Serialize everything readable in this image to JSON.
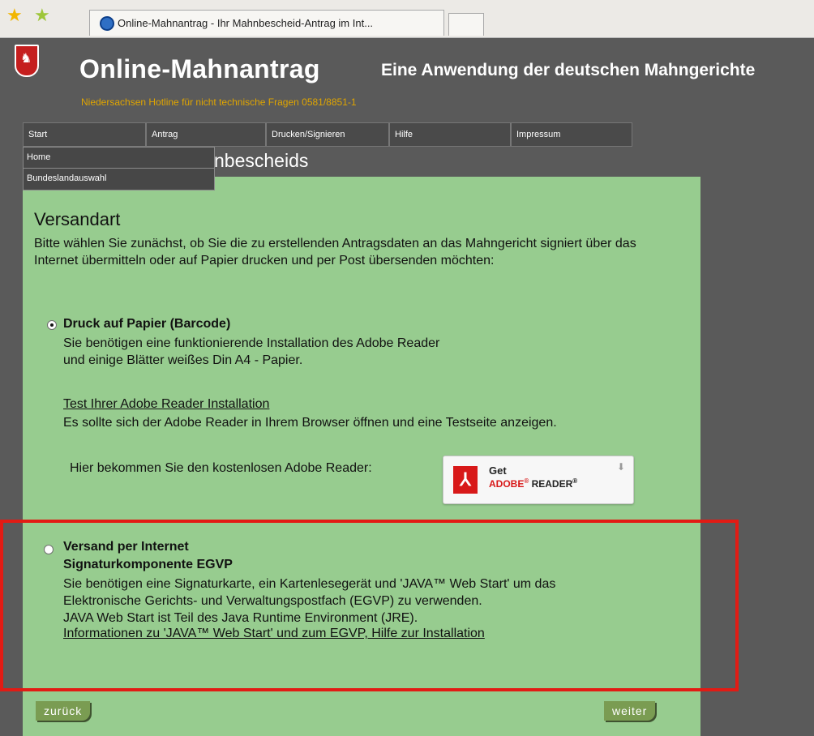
{
  "browser": {
    "tab_title": "Online-Mahnantrag - Ihr Mahnbescheid-Antrag im Int..."
  },
  "header": {
    "title": "Online-Mahnantrag",
    "subtitle": "Eine Anwendung der deutschen Mahngerichte",
    "info": "Niedersachsen   Hotline für nicht technische Fragen 0581/8851-1"
  },
  "nav": {
    "items": [
      {
        "label": "Start"
      },
      {
        "label": "Antrag"
      },
      {
        "label": "Drucken/Signieren"
      },
      {
        "label": "Hilfe"
      },
      {
        "label": "Impressum"
      }
    ],
    "dropdown": [
      "Home",
      "Bundeslandauswahl"
    ]
  },
  "main": {
    "heading": "s eines Mahnbescheids",
    "section_title": "Versandart",
    "intro": "Bitte wählen Sie zunächst, ob Sie die zu erstellenden Antragsdaten an das Mahngericht signiert über das Internet übermitteln oder auf Papier drucken und per Post übersenden möchten:",
    "option_paper": {
      "label": "Druck auf Papier (Barcode)",
      "line1": "Sie benötigen eine funktionierende Installation des Adobe Reader",
      "line2": "und einige Blätter weißes Din A4 - Papier.",
      "test_link": "Test Ihrer Adobe Reader Installation",
      "test_text": "Es sollte sich der Adobe Reader in Ihrem Browser öffnen und eine Testseite anzeigen.",
      "reader_text": "Hier bekommen Sie den kostenlosen Adobe Reader:"
    },
    "adobe_button": {
      "get": "Get",
      "brand": "ADOBE",
      "product": "READER"
    },
    "option_internet": {
      "label": "Versand per Internet",
      "sublabel": "Signaturkomponente EGVP",
      "line1": "Sie benötigen eine Signaturkarte, ein Kartenlesegerät und 'JAVA™ Web Start' um das",
      "line2": "Elektronische Gerichts- und Verwaltungspostfach (EGVP) zu verwenden.",
      "line3": "JAVA Web Start ist Teil des Java Runtime Environment (JRE).",
      "info_link": "Informationen zu 'JAVA™ Web Start' und zum EGVP, Hilfe zur Installation"
    },
    "back_label": "zurück",
    "next_label": "weiter"
  },
  "colors": {
    "content_bg": "#97cc8f",
    "header_bg": "#5a5a5a",
    "accent_orange": "#e0a500",
    "highlight": "#e21b14",
    "button": "#7a9c52"
  }
}
